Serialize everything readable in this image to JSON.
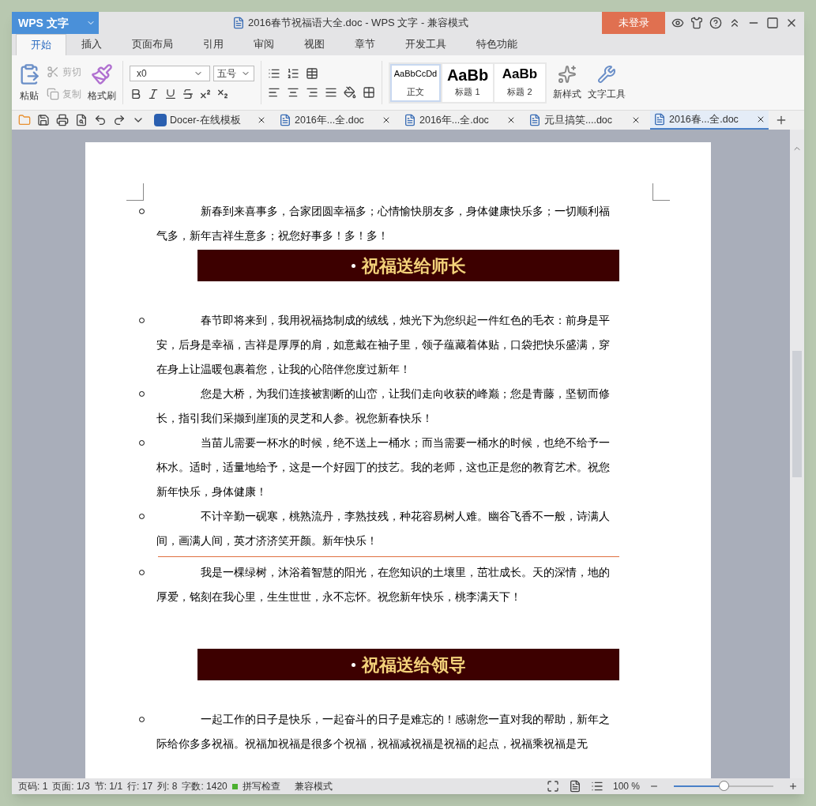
{
  "title_bar": {
    "app_menu": "WPS 文字",
    "title": "2016春节祝福语大全.doc - WPS 文字 - 兼容模式",
    "login": "未登录"
  },
  "menu_tabs": [
    {
      "label": "开始",
      "selected": true
    },
    {
      "label": "插入",
      "selected": false
    },
    {
      "label": "页面布局",
      "selected": false
    },
    {
      "label": "引用",
      "selected": false
    },
    {
      "label": "审阅",
      "selected": false
    },
    {
      "label": "视图",
      "selected": false
    },
    {
      "label": "章节",
      "selected": false
    },
    {
      "label": "开发工具",
      "selected": false
    },
    {
      "label": "特色功能",
      "selected": false
    }
  ],
  "ribbon": {
    "paste": "粘贴",
    "cut": {
      "label": "剪切",
      "disabled": true
    },
    "copy": {
      "label": "复制",
      "disabled": true
    },
    "format_painter": "格式刷",
    "font": "x0",
    "font_size": "五号",
    "styles": [
      {
        "preview": "AaBbCcDd",
        "label": "正文",
        "kind": "body",
        "selected": true
      },
      {
        "preview": "AaBb",
        "label": "标题 1",
        "kind": "h1",
        "selected": false
      },
      {
        "preview": "AaBb",
        "label": "标题 2",
        "kind": "h2",
        "selected": false
      }
    ],
    "new_style": "新样式",
    "text_tools": "文字工具"
  },
  "doc_tabs": [
    {
      "label": "Docer-在线模板",
      "kind": "docer",
      "selected": false
    },
    {
      "label": "2016年...全.doc",
      "kind": "doc",
      "selected": false
    },
    {
      "label": "2016年...全.doc",
      "kind": "doc",
      "selected": false
    },
    {
      "label": "元旦搞笑....doc",
      "kind": "doc",
      "selected": false
    },
    {
      "label": "2016春...全.doc",
      "kind": "doc",
      "selected": true
    }
  ],
  "document": [
    {
      "kind": "item",
      "text": "新春到来喜事多，合家团圆幸福多；心情愉快朋友多，身体健康快乐多；一切顺利福气多，新年吉祥生意多；祝您好事多！多！多！"
    },
    {
      "kind": "heading",
      "text": "祝福送给师长"
    },
    {
      "kind": "item",
      "text": "春节即将来到，我用祝福捻制成的绒线，烛光下为您织起一件红色的毛衣：前身是平安，后身是幸福，吉祥是厚厚的肩，如意戴在袖子里，领子蕴藏着体贴，口袋把快乐盛满，穿在身上让温暖包裹着您，让我的心陪伴您度过新年！"
    },
    {
      "kind": "item",
      "text": "您是大桥，为我们连接被割断的山峦，让我们走向收获的峰巅；您是青藤，坚韧而修长，指引我们采撷到崖顶的灵芝和人参。祝您新春快乐！"
    },
    {
      "kind": "item",
      "text": "当苗儿需要一杯水的时候，绝不送上一桶水；而当需要一桶水的时候，也绝不给予一杯水。适时，适量地给予，这是一个好园丁的技艺。我的老师，这也正是您的教育艺术。祝您新年快乐，身体健康！"
    },
    {
      "kind": "item",
      "text": "不计辛勤一砚寒，桃熟流丹，李熟技残，种花容易树人难。幽谷飞香不一般，诗满人间，画满人间，英才济济笑开颜。新年快乐！"
    },
    {
      "kind": "rule"
    },
    {
      "kind": "item",
      "text": "我是一棵绿树，沐浴着智慧的阳光，在您知识的土壤里，茁壮成长。天的深情，地的厚爱，铭刻在我心里，生生世世，永不忘怀。祝您新年快乐，桃李满天下！"
    },
    {
      "kind": "heading",
      "text": "祝福送给领导"
    },
    {
      "kind": "item",
      "text": "一起工作的日子是快乐，一起奋斗的日子是难忘的！感谢您一直对我的帮助，新年之际给你多多祝福。祝福加祝福是很多个祝福，祝福减祝福是祝福的起点，祝福乘祝福是无"
    }
  ],
  "status_bar": {
    "fields": [
      "页码: 1",
      "页面: 1/3",
      "节: 1/1",
      "行: 17",
      "列: 8",
      "字数: 1420"
    ],
    "spell_check": "拼写检查",
    "mode": "兼容模式",
    "zoom": "100 %",
    "level": 0.5
  }
}
